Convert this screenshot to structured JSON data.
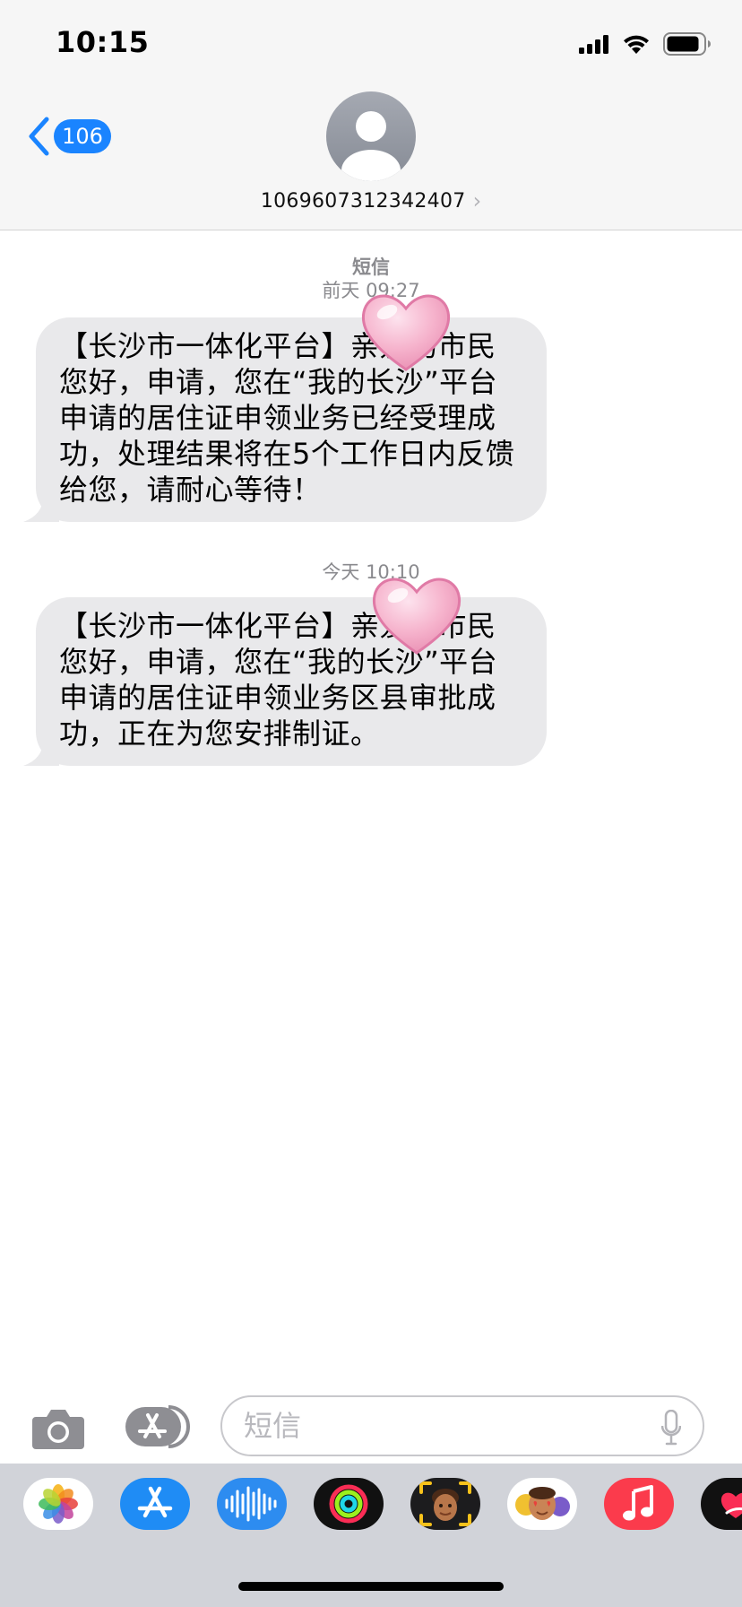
{
  "status_bar": {
    "time": "10:15"
  },
  "header": {
    "back_count": "106",
    "contact_number": "1069607312342407",
    "chevron": "›"
  },
  "conversation": {
    "service_label": "短信",
    "messages": [
      {
        "timestamp": "前天 09:27",
        "text": "【长沙市一体化平台】亲爱的市民您好，申请，您在“我的长沙”平台申请的居住证申领业务已经受理成功，处理结果将在5个工作日内反馈给您，请耐心等待！",
        "sticker": "heart-sticker"
      },
      {
        "timestamp": "今天 10:10",
        "text": "【长沙市一体化平台】亲爱的市民您好，申请，您在“我的长沙”平台申请的居住证申领业务区县审批成功，正在为您安排制证。",
        "sticker": "heart-sticker"
      }
    ]
  },
  "composer": {
    "placeholder": "短信"
  },
  "app_drawer": {
    "apps": [
      "photos",
      "app-store",
      "audio-messages",
      "activity",
      "memoji-stickers",
      "animoji",
      "music",
      "digital-touch"
    ]
  },
  "colors": {
    "accent": "#1a84ff",
    "bubble": "#e9e9eb",
    "drawer": "#d1d3d9"
  }
}
